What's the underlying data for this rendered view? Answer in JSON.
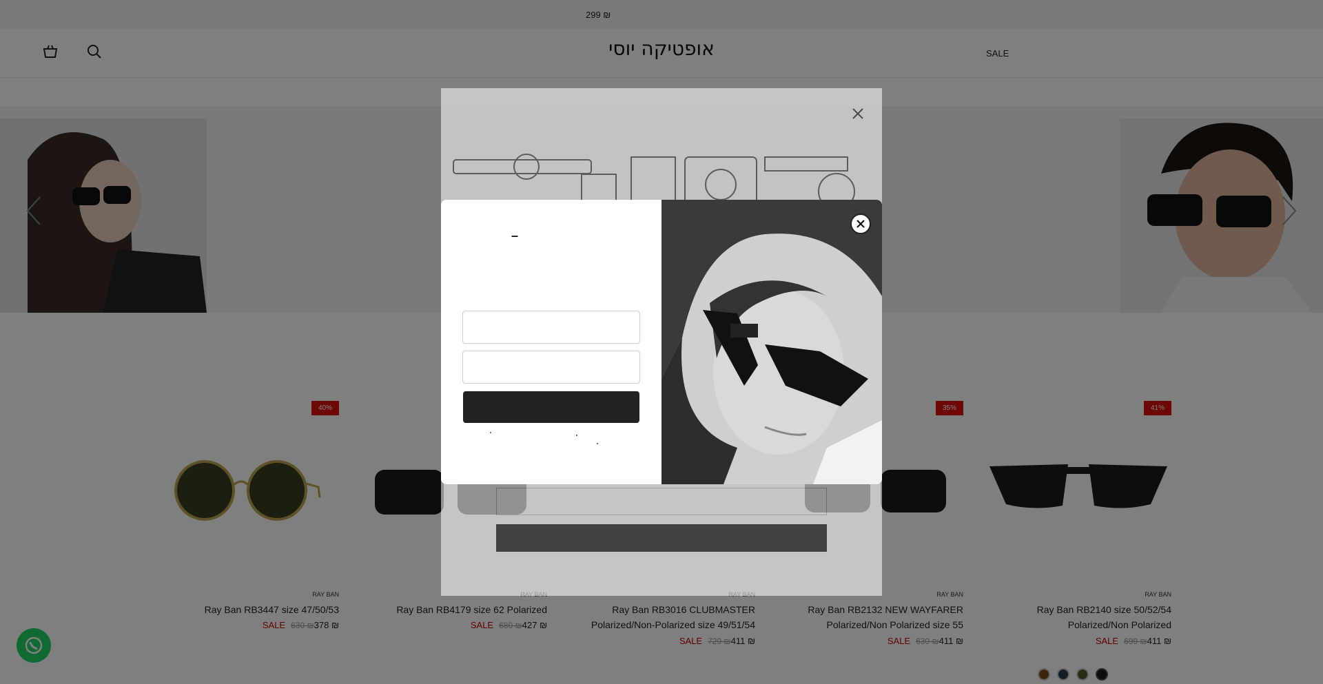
{
  "announcement": {
    "text": "299 ₪"
  },
  "header": {
    "logo": "אופטיקה יוסי",
    "nav_sale": "SALE",
    "icons": [
      "cart-icon",
      "search-icon"
    ]
  },
  "hero": {
    "icons": [
      "chevron-left-icon",
      "chevron-right-icon"
    ]
  },
  "products": [
    {
      "brand": "RAY BAN",
      "title": "Ray Ban RB3447 size 47/50/53",
      "badge": "40%",
      "sale_label": "SALE",
      "old_price": "630 ₪",
      "price": "378 ₪"
    },
    {
      "brand": "RAY BAN",
      "title": "Ray Ban RB4179 size 62 Polarized",
      "badge": "",
      "sale_label": "SALE",
      "old_price": "680 ₪",
      "price": "427 ₪"
    },
    {
      "brand": "RAY BAN",
      "title": "Ray Ban RB3016 CLUBMASTER Polarized/Non-Polarized size 49/51/54",
      "badge": "",
      "sale_label": "SALE",
      "old_price": "729 ₪",
      "price": "411 ₪"
    },
    {
      "brand": "RAY BAN",
      "title": "Ray Ban RB2132 NEW WAYFARER Polarized/Non Polarized size 55",
      "badge": "35%",
      "sale_label": "SALE",
      "old_price": "630 ₪",
      "price": "411 ₪"
    },
    {
      "brand": "RAY BAN",
      "title": "Ray Ban RB2140 size 50/52/54 Polarized/Non Polarized",
      "badge": "41%",
      "sale_label": "SALE",
      "old_price": "699 ₪",
      "price": "411 ₪"
    }
  ],
  "swatch_colors": [
    "#7a4a1a",
    "#2b3a55",
    "#4f5a2a",
    "#1a1a1a"
  ],
  "colors": {
    "sale_red": "#cc0000",
    "whatsapp_green": "#25d366",
    "button_dark": "#222222"
  },
  "popup": {
    "title": "–",
    "close_icon": "close-icon",
    "email_placeholder": "",
    "phone_placeholder": ""
  }
}
